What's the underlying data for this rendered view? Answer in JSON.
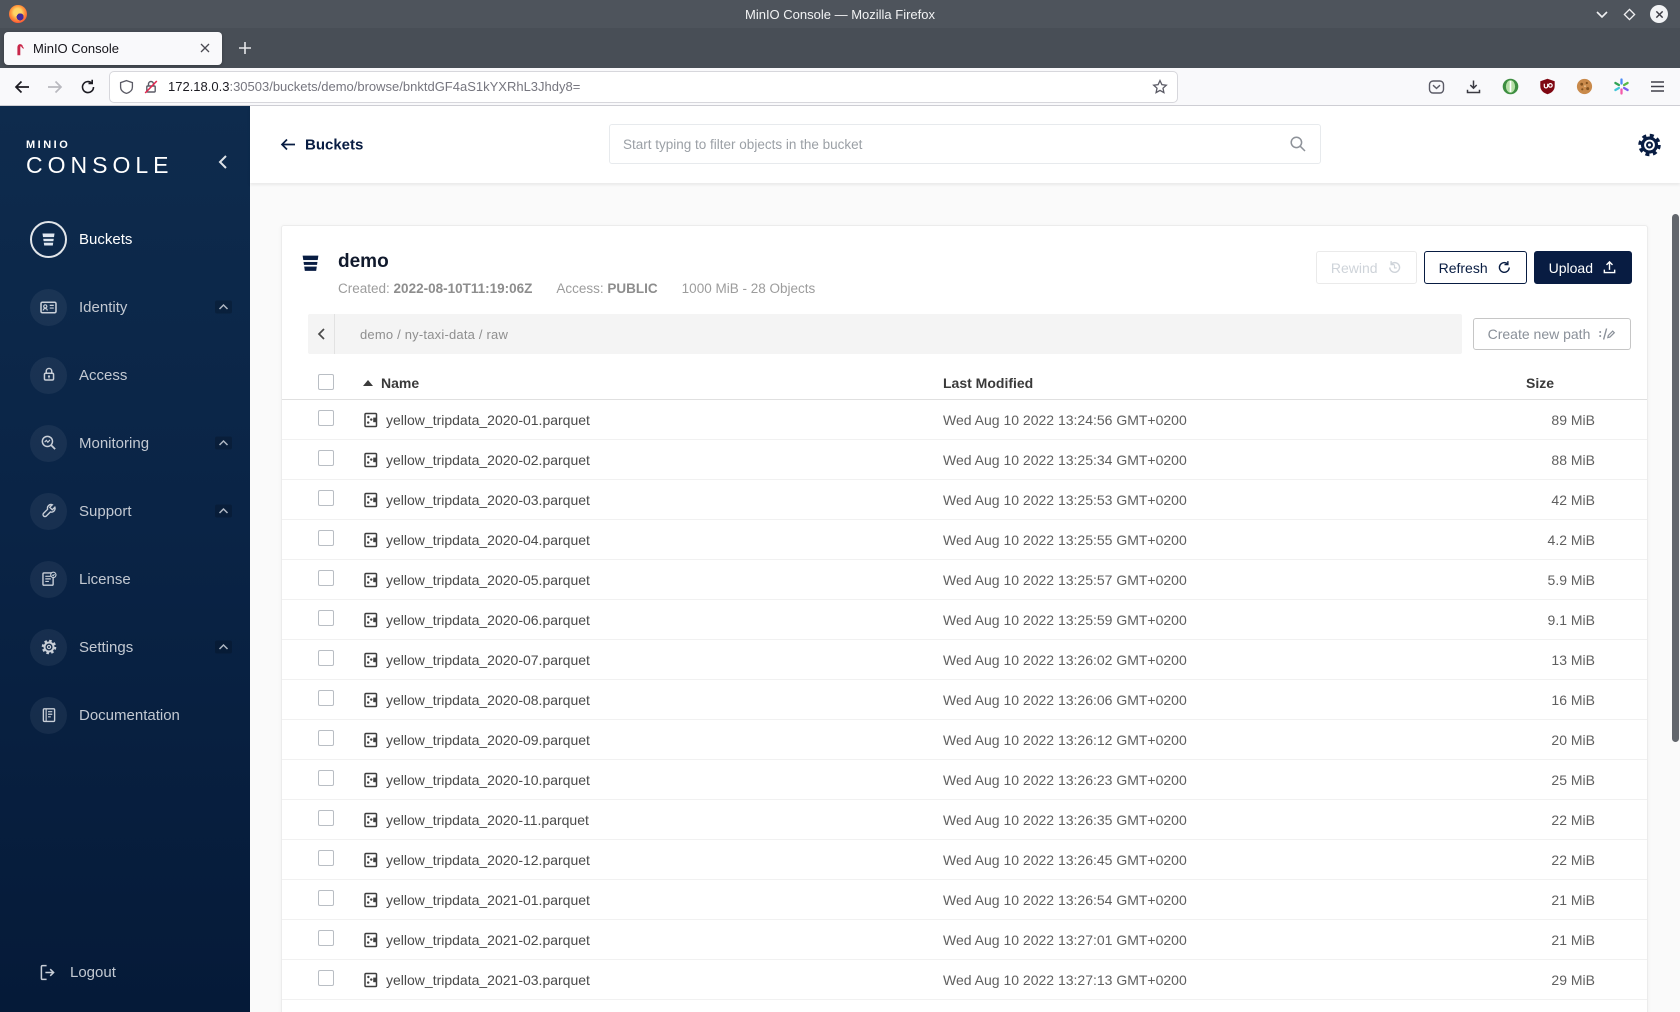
{
  "window": {
    "title": "MinIO Console — Mozilla Firefox"
  },
  "browser": {
    "tab_title": "MinIO Console",
    "url_host": "172.18.0.3",
    "url_rest": ":30503/buckets/demo/browse/bnktdGF4aS1kYXRhL3Jhdy8="
  },
  "sidebar": {
    "logo_line1": "MINIO",
    "logo_line2": "CONSOLE",
    "items": [
      {
        "label": "Buckets",
        "icon": "bucket-icon",
        "selected": true
      },
      {
        "label": "Identity",
        "icon": "identity-icon",
        "expandable": true
      },
      {
        "label": "Access",
        "icon": "access-lock-icon"
      },
      {
        "label": "Monitoring",
        "icon": "monitoring-icon",
        "expandable": true
      },
      {
        "label": "Support",
        "icon": "support-wrench-icon",
        "expandable": true
      },
      {
        "label": "License",
        "icon": "license-icon"
      },
      {
        "label": "Settings",
        "icon": "settings-gear-icon",
        "expandable": true
      },
      {
        "label": "Documentation",
        "icon": "documentation-icon"
      }
    ],
    "logout_label": "Logout"
  },
  "header": {
    "back_label": "Buckets",
    "search_placeholder": "Start typing to filter objects in the bucket"
  },
  "bucket": {
    "name": "demo",
    "created_label": "Created:",
    "created_value": "2022-08-10T11:19:06Z",
    "access_label": "Access:",
    "access_value": "PUBLIC",
    "summary": "1000 MiB - 28 Objects",
    "rewind_label": "Rewind",
    "refresh_label": "Refresh",
    "upload_label": "Upload"
  },
  "browse": {
    "path": "demo / ny-taxi-data / raw",
    "create_path_label": "Create new path"
  },
  "table": {
    "columns": {
      "name": "Name",
      "modified": "Last Modified",
      "size": "Size"
    },
    "rows": [
      {
        "name": "yellow_tripdata_2020-01.parquet",
        "modified": "Wed Aug 10 2022 13:24:56 GMT+0200",
        "size": "89 MiB"
      },
      {
        "name": "yellow_tripdata_2020-02.parquet",
        "modified": "Wed Aug 10 2022 13:25:34 GMT+0200",
        "size": "88 MiB"
      },
      {
        "name": "yellow_tripdata_2020-03.parquet",
        "modified": "Wed Aug 10 2022 13:25:53 GMT+0200",
        "size": "42 MiB"
      },
      {
        "name": "yellow_tripdata_2020-04.parquet",
        "modified": "Wed Aug 10 2022 13:25:55 GMT+0200",
        "size": "4.2 MiB"
      },
      {
        "name": "yellow_tripdata_2020-05.parquet",
        "modified": "Wed Aug 10 2022 13:25:57 GMT+0200",
        "size": "5.9 MiB"
      },
      {
        "name": "yellow_tripdata_2020-06.parquet",
        "modified": "Wed Aug 10 2022 13:25:59 GMT+0200",
        "size": "9.1 MiB"
      },
      {
        "name": "yellow_tripdata_2020-07.parquet",
        "modified": "Wed Aug 10 2022 13:26:02 GMT+0200",
        "size": "13 MiB"
      },
      {
        "name": "yellow_tripdata_2020-08.parquet",
        "modified": "Wed Aug 10 2022 13:26:06 GMT+0200",
        "size": "16 MiB"
      },
      {
        "name": "yellow_tripdata_2020-09.parquet",
        "modified": "Wed Aug 10 2022 13:26:12 GMT+0200",
        "size": "20 MiB"
      },
      {
        "name": "yellow_tripdata_2020-10.parquet",
        "modified": "Wed Aug 10 2022 13:26:23 GMT+0200",
        "size": "25 MiB"
      },
      {
        "name": "yellow_tripdata_2020-11.parquet",
        "modified": "Wed Aug 10 2022 13:26:35 GMT+0200",
        "size": "22 MiB"
      },
      {
        "name": "yellow_tripdata_2020-12.parquet",
        "modified": "Wed Aug 10 2022 13:26:45 GMT+0200",
        "size": "22 MiB"
      },
      {
        "name": "yellow_tripdata_2021-01.parquet",
        "modified": "Wed Aug 10 2022 13:26:54 GMT+0200",
        "size": "21 MiB"
      },
      {
        "name": "yellow_tripdata_2021-02.parquet",
        "modified": "Wed Aug 10 2022 13:27:01 GMT+0200",
        "size": "21 MiB"
      },
      {
        "name": "yellow_tripdata_2021-03.parquet",
        "modified": "Wed Aug 10 2022 13:27:13 GMT+0200",
        "size": "29 MiB"
      }
    ]
  },
  "colors": {
    "accent_navy": "#081C42",
    "sidebar_top": "#0E2B4D",
    "sidebar_bottom": "#051A38",
    "titlebar": "#4E545C",
    "minio_red": "#C9274A"
  }
}
